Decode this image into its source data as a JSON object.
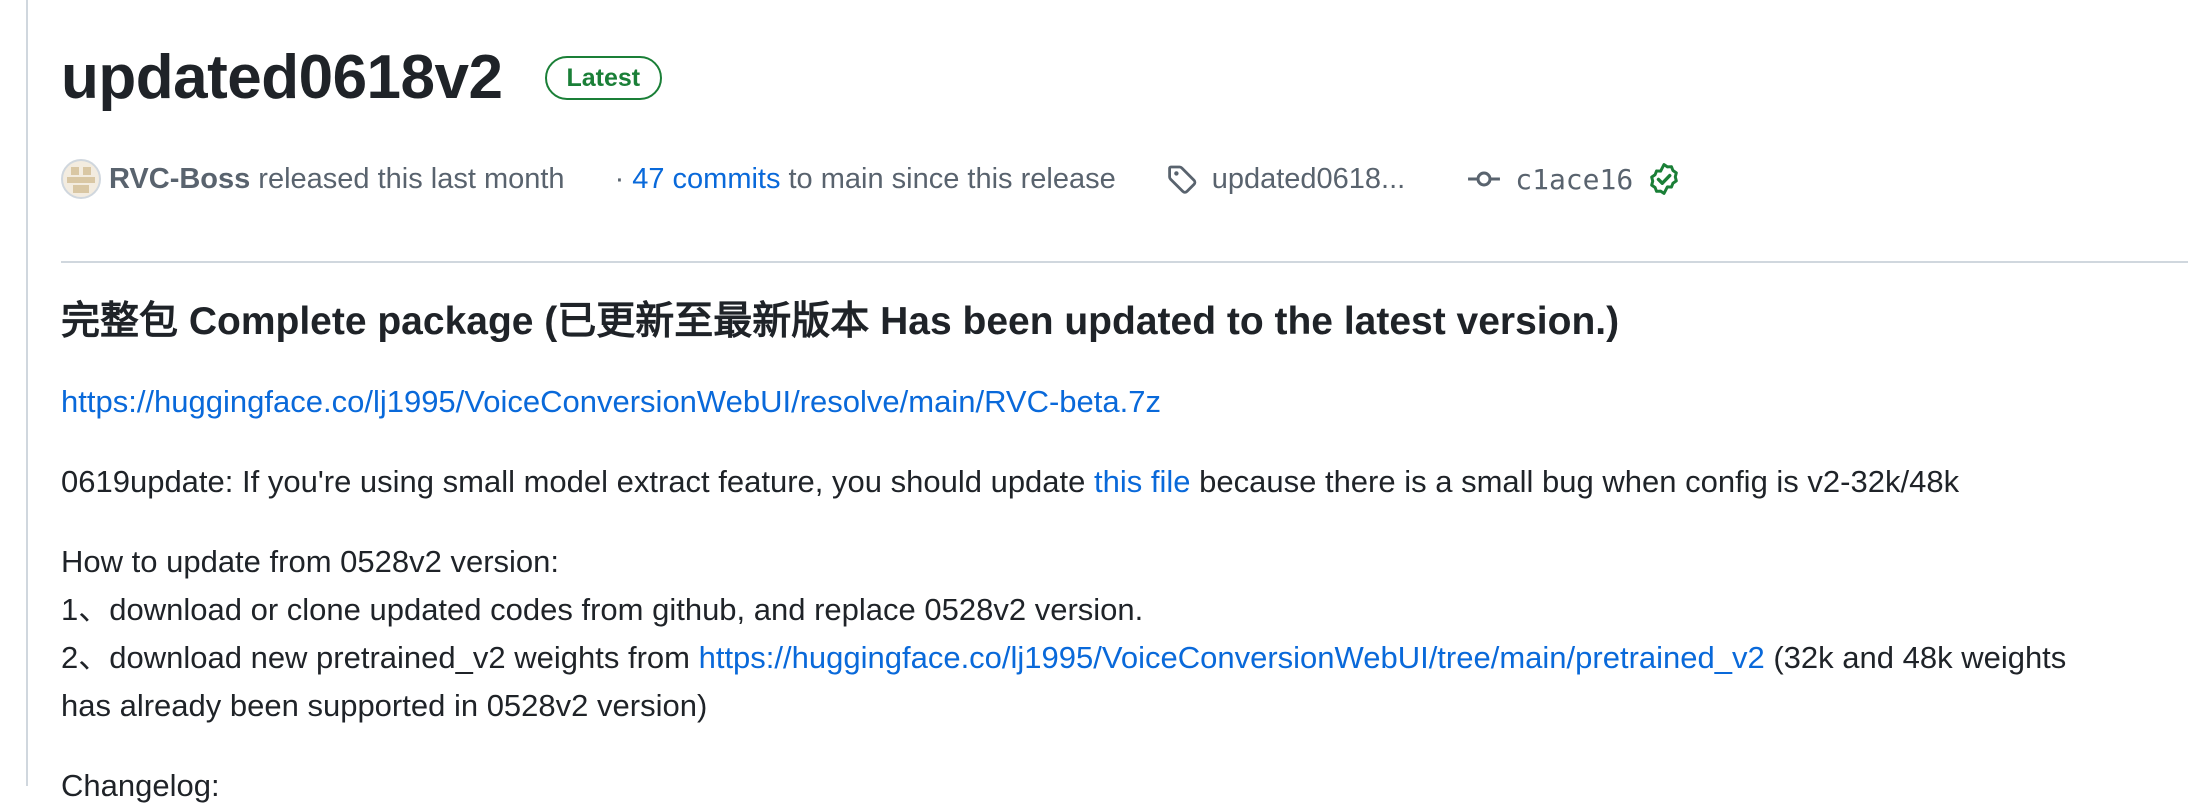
{
  "release": {
    "title": "updated0618v2",
    "badge": "Latest",
    "author": "RVC-Boss",
    "released_text": "released this last month",
    "separator": "·",
    "commits_link": "47 commits",
    "commits_suffix": "to main since this release",
    "tag": "updated0618...",
    "commit_sha": "c1ace16"
  },
  "notes": {
    "heading": "完整包 Complete package (已更新至最新版本 Has been updated to the latest version.)",
    "package_link": "https://huggingface.co/lj1995/VoiceConversionWebUI/resolve/main/RVC-beta.7z",
    "update_prefix": "0619update: If you're using small model extract feature, you should update",
    "update_link": "this file",
    "update_suffix": "because there is a small bug when config is v2-32k/48k",
    "how_to_title": "How to update from 0528v2 version:",
    "step1": "1、download or clone updated codes from github, and replace 0528v2 version.",
    "step2_prefix": "2、download new pretrained_v2 weights from",
    "step2_link": "https://huggingface.co/lj1995/VoiceConversionWebUI/tree/main/pretrained_v2",
    "step2_suffix": "(32k and 48k weights",
    "step2_cont": "has already been supported in 0528v2 version)",
    "changelog_partial": "Changelog:"
  },
  "colors": {
    "link": "#0969da",
    "badge_green": "#1a7f37",
    "muted": "#59636e",
    "border": "#d0d7de"
  },
  "icons": [
    "avatar",
    "tag-icon",
    "git-commit-icon",
    "verified-check-icon"
  ]
}
